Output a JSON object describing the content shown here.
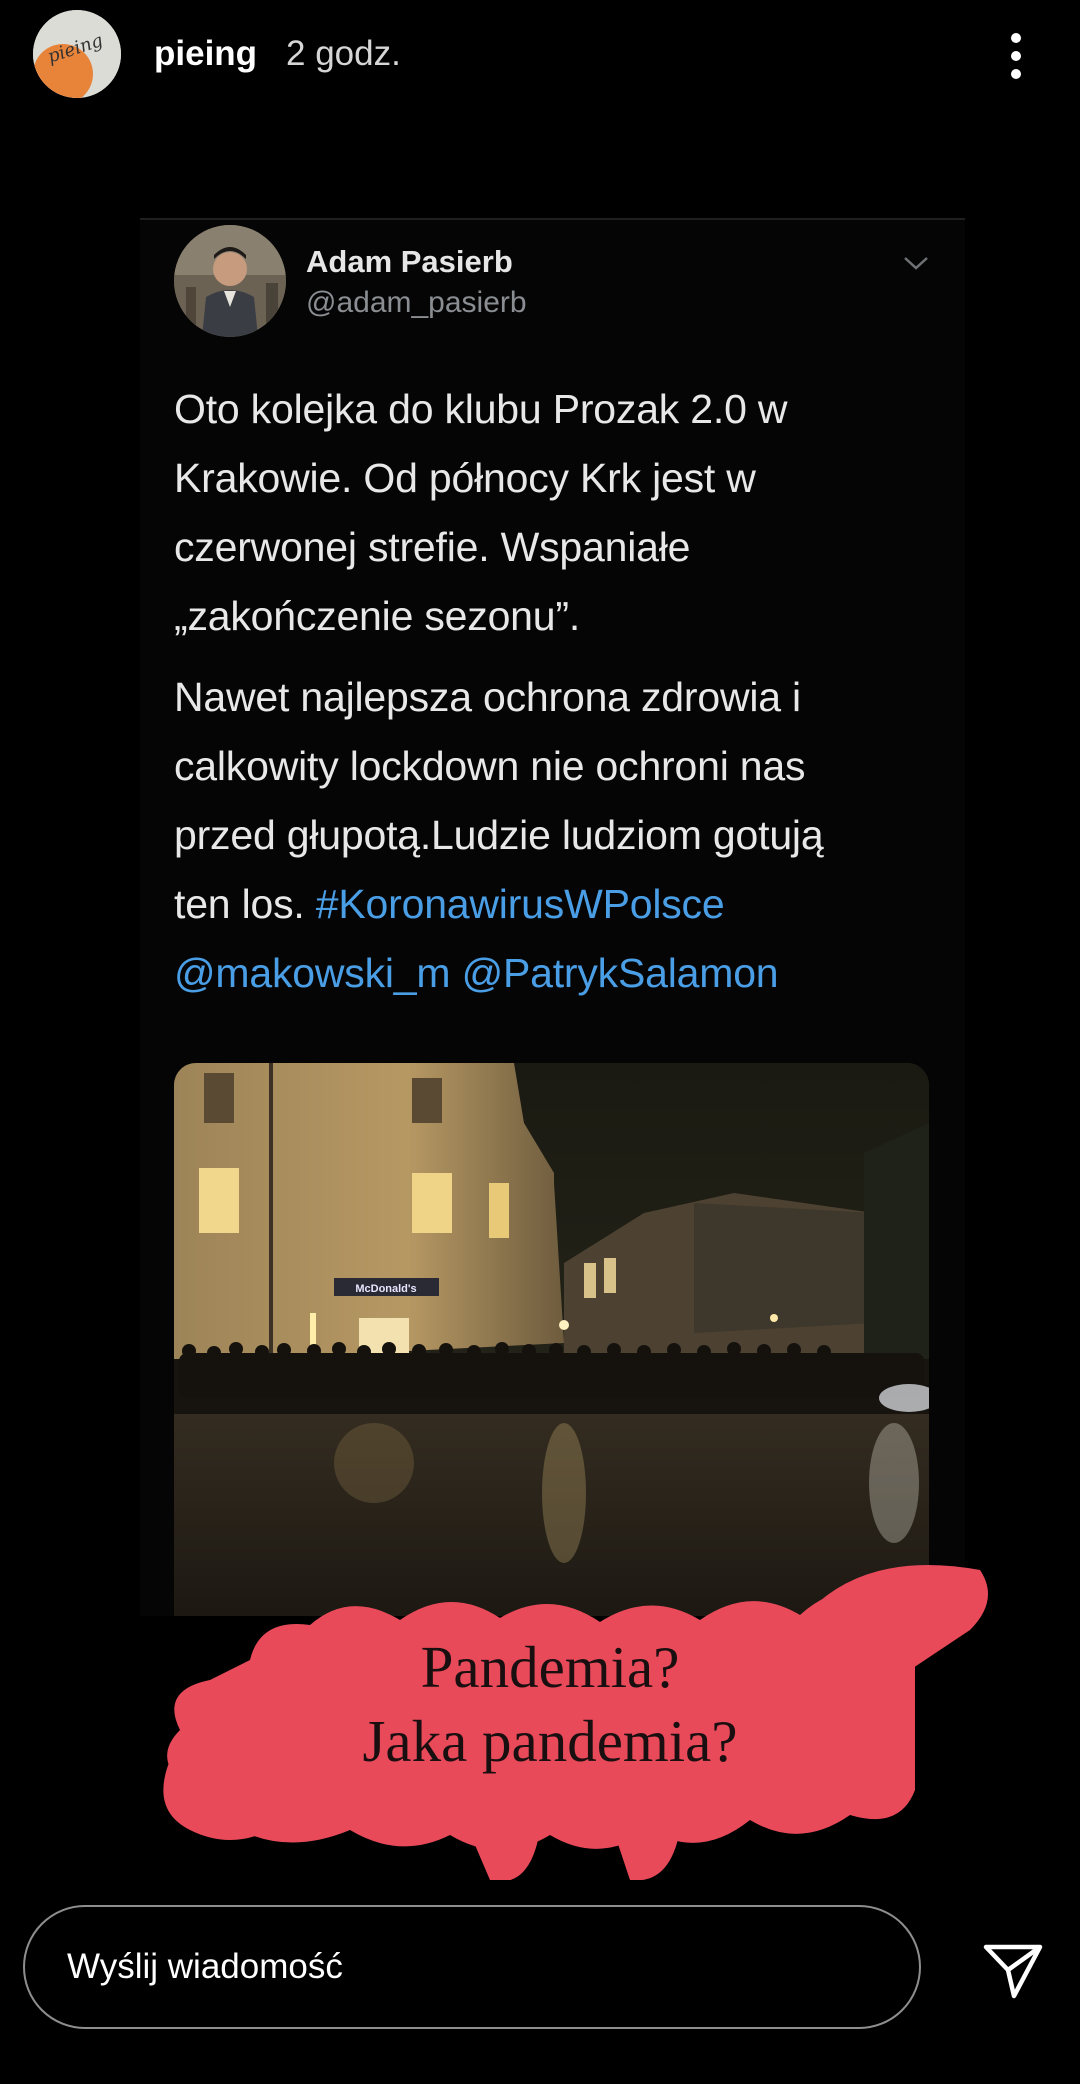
{
  "header": {
    "username": "pieing",
    "time": "2 godz.",
    "avatar_text": "pieing"
  },
  "tweet": {
    "name": "Adam Pasierb",
    "handle": "@adam_pasierb",
    "paragraph1": [
      "Oto kolejka do klubu Prozak 2.0 w",
      "Krakowie. Od północy Krk jest w",
      "czerwonej strefie. Wspaniałe",
      "„zakończenie sezonu”."
    ],
    "paragraph2": {
      "line1": "Nawet najlepsza ochrona zdrowia i",
      "line2": "calkowity lockdown nie ochroni nas",
      "line3": "przed głupotą.Ludzie ludziom gotują",
      "line4_text": "ten los. ",
      "hashtag": "#KoronawirusWPolsce",
      "mention1": "@makowski_m",
      "mention2": "@PatrykSalamon"
    },
    "photo_sign": "McDonald's"
  },
  "sticker": {
    "line1": "Pandemia?",
    "line2": "Jaka pandemia?"
  },
  "reply": {
    "placeholder": "Wyślij wiadomość"
  },
  "icons": {
    "more": "more-vertical-icon",
    "chevron": "chevron-down-icon",
    "send": "paper-plane-icon"
  },
  "colors": {
    "background": "#000000",
    "link": "#4a9ee6",
    "sticker": "#e94a5a"
  }
}
